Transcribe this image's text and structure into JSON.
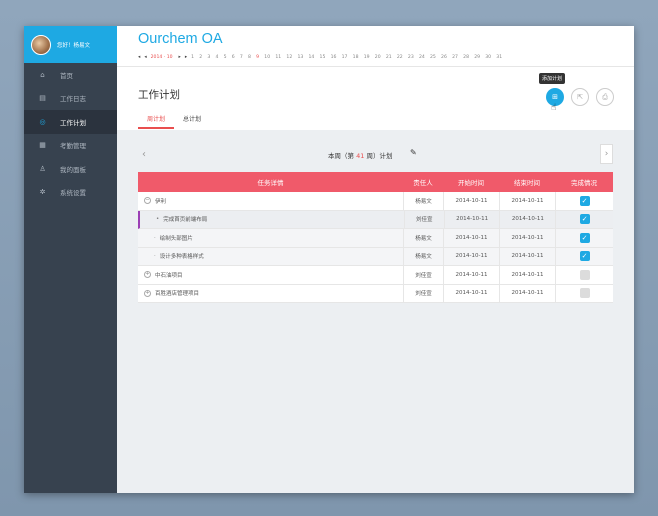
{
  "user": {
    "greeting": "您好！杨易文"
  },
  "sidebar": {
    "items": [
      {
        "label": "首页",
        "icon": "⌂",
        "icon_name": "home-icon"
      },
      {
        "label": "工作日志",
        "icon": "▤",
        "icon_name": "log-icon"
      },
      {
        "label": "工作计划",
        "icon": "◎",
        "icon_name": "plan-icon"
      },
      {
        "label": "考勤管理",
        "icon": "▦",
        "icon_name": "calendar-icon"
      },
      {
        "label": "我的面板",
        "icon": "♙",
        "icon_name": "user-icon"
      },
      {
        "label": "系统设置",
        "icon": "✲",
        "icon_name": "settings-icon"
      }
    ]
  },
  "app": {
    "title": "Ourchem OA"
  },
  "calendar": {
    "month": "2014 · 10",
    "days": [
      "1",
      "2",
      "3",
      "4",
      "5",
      "6",
      "7",
      "8",
      "9",
      "10",
      "11",
      "12",
      "13",
      "14",
      "15",
      "16",
      "17",
      "18",
      "19",
      "20",
      "21",
      "22",
      "23",
      "24",
      "25",
      "26",
      "27",
      "28",
      "29",
      "30",
      "31"
    ],
    "today": "9"
  },
  "page": {
    "title": "工作计划"
  },
  "tabs": {
    "week": "周计划",
    "total": "总计划"
  },
  "actions": {
    "add_tooltip": "添加计划"
  },
  "week": {
    "prefix": "本周（第",
    "number": "41",
    "suffix": "周）计划"
  },
  "table": {
    "headers": {
      "task": "任务详情",
      "owner": "责任人",
      "start": "开始时间",
      "end": "结束时间",
      "status": "完成情况"
    },
    "rows": [
      {
        "toggle": "−",
        "task": "伊利",
        "owner": "杨易文",
        "start": "2014-10-11",
        "end": "2014-10-11",
        "done": true
      },
      {
        "task": "完成首页前端布局",
        "owner": "刘佳宣",
        "start": "2014-10-11",
        "end": "2014-10-11",
        "done": true
      },
      {
        "task": "绘制头部图片",
        "owner": "杨易文",
        "start": "2014-10-11",
        "end": "2014-10-11",
        "done": true
      },
      {
        "task": "设计多种表格样式",
        "owner": "杨易文",
        "start": "2014-10-11",
        "end": "2014-10-11",
        "done": true
      },
      {
        "toggle": "+",
        "task": "中石油项目",
        "owner": "刘佳宣",
        "start": "2014-10-11",
        "end": "2014-10-11",
        "done": false
      },
      {
        "toggle": "+",
        "task": "百胜酒店管理项目",
        "owner": "刘佳宣",
        "start": "2014-10-11",
        "end": "2014-10-11",
        "done": false
      }
    ]
  },
  "colors": {
    "accent": "#1ea9e3",
    "header_red": "#f05a6a",
    "sidebar": "#37424f"
  }
}
